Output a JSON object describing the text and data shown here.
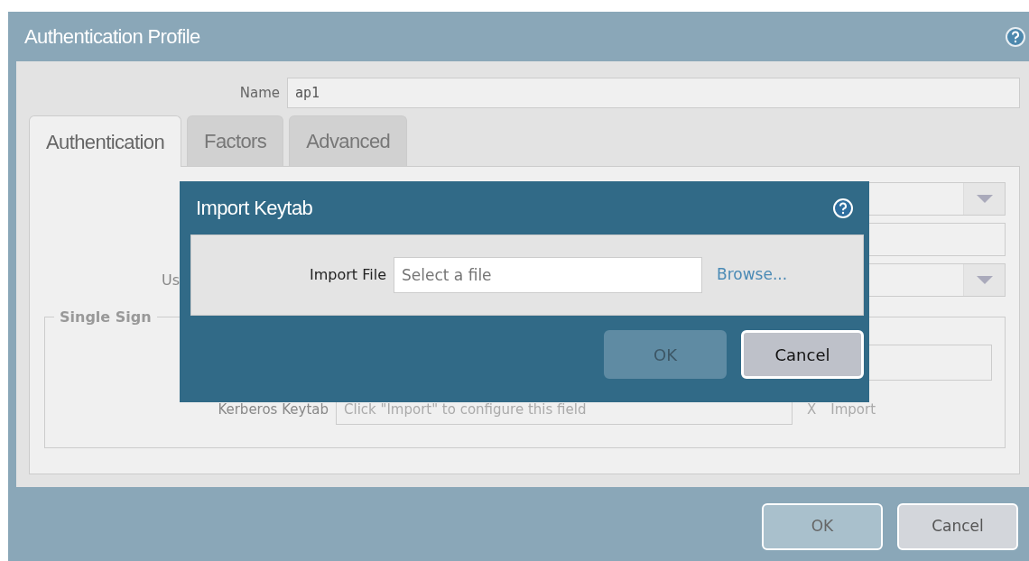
{
  "window": {
    "title": "Authentication Profile"
  },
  "name_field": {
    "label": "Name",
    "value": "ap1"
  },
  "tabs": [
    {
      "label": "Authentication",
      "selected": true
    },
    {
      "label": "Factors",
      "selected": false
    },
    {
      "label": "Advanced",
      "selected": false
    }
  ],
  "form_rows": [
    {
      "kind": "dropdown"
    },
    {
      "kind": "text"
    },
    {
      "kind": "dropdown",
      "label": "Us"
    }
  ],
  "sso": {
    "legend": "Single Sign",
    "rows": [
      {
        "kind": "text"
      },
      {
        "kind": "keytab",
        "label": "Kerberos Keytab",
        "placeholder": "Click \"Import\" to configure this field",
        "clear": "X",
        "import": "Import"
      }
    ]
  },
  "buttons": [
    {
      "label": "OK",
      "disabled": true
    },
    {
      "label": "Cancel",
      "disabled": false
    }
  ],
  "modal": {
    "title": "Import Keytab",
    "field": {
      "label": "Import File",
      "placeholder": "Select a file"
    },
    "browse": "Browse...",
    "buttons": [
      {
        "label": "OK",
        "disabled": true
      },
      {
        "label": "Cancel",
        "disabled": false
      }
    ]
  }
}
